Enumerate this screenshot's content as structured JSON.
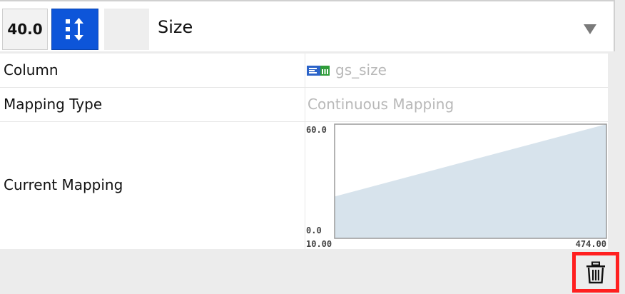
{
  "header": {
    "default_value": "40.0",
    "property_name": "Size",
    "mapping_button_icon": "resize-vertical-icon",
    "dropdown_icon": "dropdown-arrow-icon"
  },
  "table": {
    "column": {
      "label": "Column",
      "value": "gs_size",
      "icon": "numeric-column-icon"
    },
    "mapping_type": {
      "label": "Mapping Type",
      "value": "Continuous Mapping"
    },
    "current_mapping": {
      "label": "Current Mapping"
    }
  },
  "chart_data": {
    "type": "area",
    "x": [
      10.0,
      474.0
    ],
    "y": [
      22,
      60
    ],
    "x_tick_labels": [
      "10.00",
      "474.00"
    ],
    "y_tick_labels": [
      "60.0",
      "0.0"
    ],
    "xlim": [
      10.0,
      474.0
    ],
    "ylim": [
      0.0,
      60.0
    ],
    "fill_color": "#d7e3ec",
    "grid": false
  },
  "footer": {
    "delete_icon": "trash-icon",
    "highlight_color": "#ff1f1f"
  },
  "colors": {
    "accent": "#0d55d9",
    "muted_text": "#b8b8b8"
  }
}
